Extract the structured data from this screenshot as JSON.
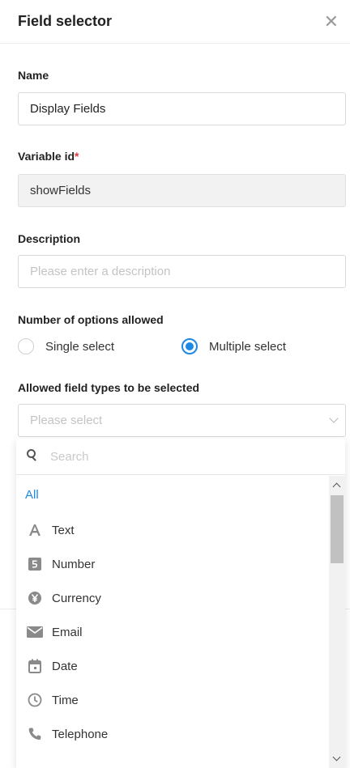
{
  "header": {
    "title": "Field selector",
    "close_glyph": "✕"
  },
  "name": {
    "label": "Name",
    "value": "Display Fields"
  },
  "variable_id": {
    "label": "Variable id",
    "required_mark": "*",
    "value": "showFields"
  },
  "description": {
    "label": "Description",
    "placeholder": "Please enter a description"
  },
  "options_allowed": {
    "label": "Number of options allowed",
    "single_label": "Single select",
    "multiple_label": "Multiple select",
    "selected": "multiple"
  },
  "field_types": {
    "label": "Allowed field types to be selected",
    "placeholder": "Please select"
  },
  "dropdown": {
    "search_placeholder": "Search",
    "all_label": "All",
    "items": [
      {
        "label": "Text",
        "icon": "text-icon"
      },
      {
        "label": "Number",
        "icon": "number-icon"
      },
      {
        "label": "Currency",
        "icon": "currency-icon"
      },
      {
        "label": "Email",
        "icon": "email-icon"
      },
      {
        "label": "Date",
        "icon": "date-icon"
      },
      {
        "label": "Time",
        "icon": "time-icon"
      },
      {
        "label": "Telephone",
        "icon": "telephone-icon"
      }
    ]
  },
  "colors": {
    "accent": "#1e88e5",
    "required": "#e0383e",
    "icon": "#8a8a8a"
  }
}
